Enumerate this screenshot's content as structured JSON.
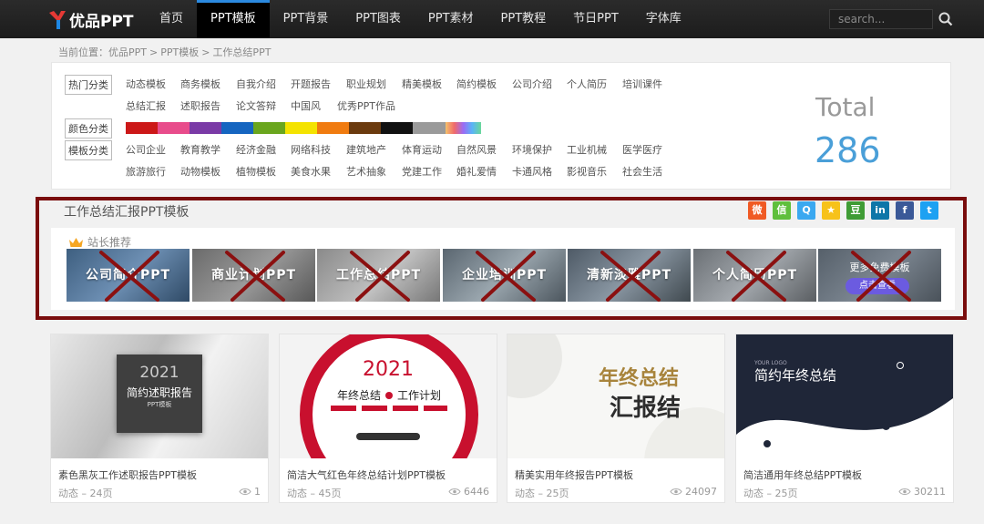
{
  "logo": {
    "text": "优品PPT"
  },
  "nav": {
    "items": [
      "首页",
      "PPT模板",
      "PPT背景",
      "PPT图表",
      "PPT素材",
      "PPT教程",
      "节日PPT",
      "字体库"
    ],
    "active": 1
  },
  "search": {
    "placeholder": "search..."
  },
  "breadcrumb": {
    "prefix": "当前位置：",
    "items": [
      "优品PPT",
      "PPT模板",
      "工作总结PPT"
    ],
    "separator": ">"
  },
  "filters": {
    "hot_label": "热门分类",
    "hot_row1": [
      "动态模板",
      "商务模板",
      "自我介绍",
      "开题报告",
      "职业规划",
      "精美模板",
      "简约模板",
      "公司介绍",
      "个人简历",
      "培训课件"
    ],
    "hot_row2": [
      "总结汇报",
      "述职报告",
      "论文答辩",
      "中国风",
      "优秀PPT作品"
    ],
    "color_label": "颜色分类",
    "colors": [
      "#cc1818",
      "#e84c8b",
      "#7a3aa6",
      "#1565c0",
      "#6aa61e",
      "#f4e300",
      "#f07b10",
      "#6b3a0e",
      "#111111",
      "#9a9a9a"
    ],
    "template_label": "模板分类",
    "template_row1": [
      "公司企业",
      "教育教学",
      "经济金融",
      "网络科技",
      "建筑地产",
      "体育运动",
      "自然风景",
      "环境保护",
      "工业机械",
      "医学医疗"
    ],
    "template_row2": [
      "旅游旅行",
      "动物模板",
      "植物模板",
      "美食水果",
      "艺术抽象",
      "党建工作",
      "婚礼爱情",
      "卡通风格",
      "影视音乐",
      "社会生活"
    ]
  },
  "total": {
    "label": "Total",
    "value": "286"
  },
  "section": {
    "title": "工作总结汇报PPT模板"
  },
  "share": [
    {
      "icon": "weibo-icon",
      "color": "#f05a24",
      "glyph": "微"
    },
    {
      "icon": "wechat-icon",
      "color": "#5fbf3c",
      "glyph": "信"
    },
    {
      "icon": "qq-icon",
      "color": "#3aa8f0",
      "glyph": "Q"
    },
    {
      "icon": "qzone-icon",
      "color": "#f7c21a",
      "glyph": "★"
    },
    {
      "icon": "douban-icon",
      "color": "#3f9c35",
      "glyph": "豆"
    },
    {
      "icon": "linkedin-icon",
      "color": "#0e76a8",
      "glyph": "in"
    },
    {
      "icon": "facebook-icon",
      "color": "#3b5998",
      "glyph": "f"
    },
    {
      "icon": "twitter-icon",
      "color": "#1da1f2",
      "glyph": "t"
    }
  ],
  "recommend": {
    "heading": "站长推荐",
    "cards": [
      "公司简介PPT",
      "商业计划PPT",
      "工作总结PPT",
      "企业培训PPT",
      "清新淡雅PPT",
      "个人简历PPT"
    ],
    "more_title": "更多免费模板",
    "more_button": "点击查看"
  },
  "products": [
    {
      "title": "素色黑灰工作述职报告PPT模板",
      "meta": "动态 – 24页",
      "views": "1",
      "thumb_year": "2021",
      "thumb_title": "简约述职报告",
      "thumb_sub": "PPT模板"
    },
    {
      "title": "简洁大气红色年终总结计划PPT模板",
      "meta": "动态 – 45页",
      "views": "6446",
      "thumb_year": "2021",
      "thumb_title": "年终总结",
      "thumb_title2": "工作计划"
    },
    {
      "title": "精美实用年终报告PPT模板",
      "meta": "动态 – 25页",
      "views": "24097",
      "thumb_title": "年终总结",
      "thumb_title2": "汇报结"
    },
    {
      "title": "简洁通用年终总结PPT模板",
      "meta": "动态 – 25页",
      "views": "30211",
      "thumb_title": "简约年终总结",
      "thumb_sub": "YOUR LOGO"
    }
  ]
}
